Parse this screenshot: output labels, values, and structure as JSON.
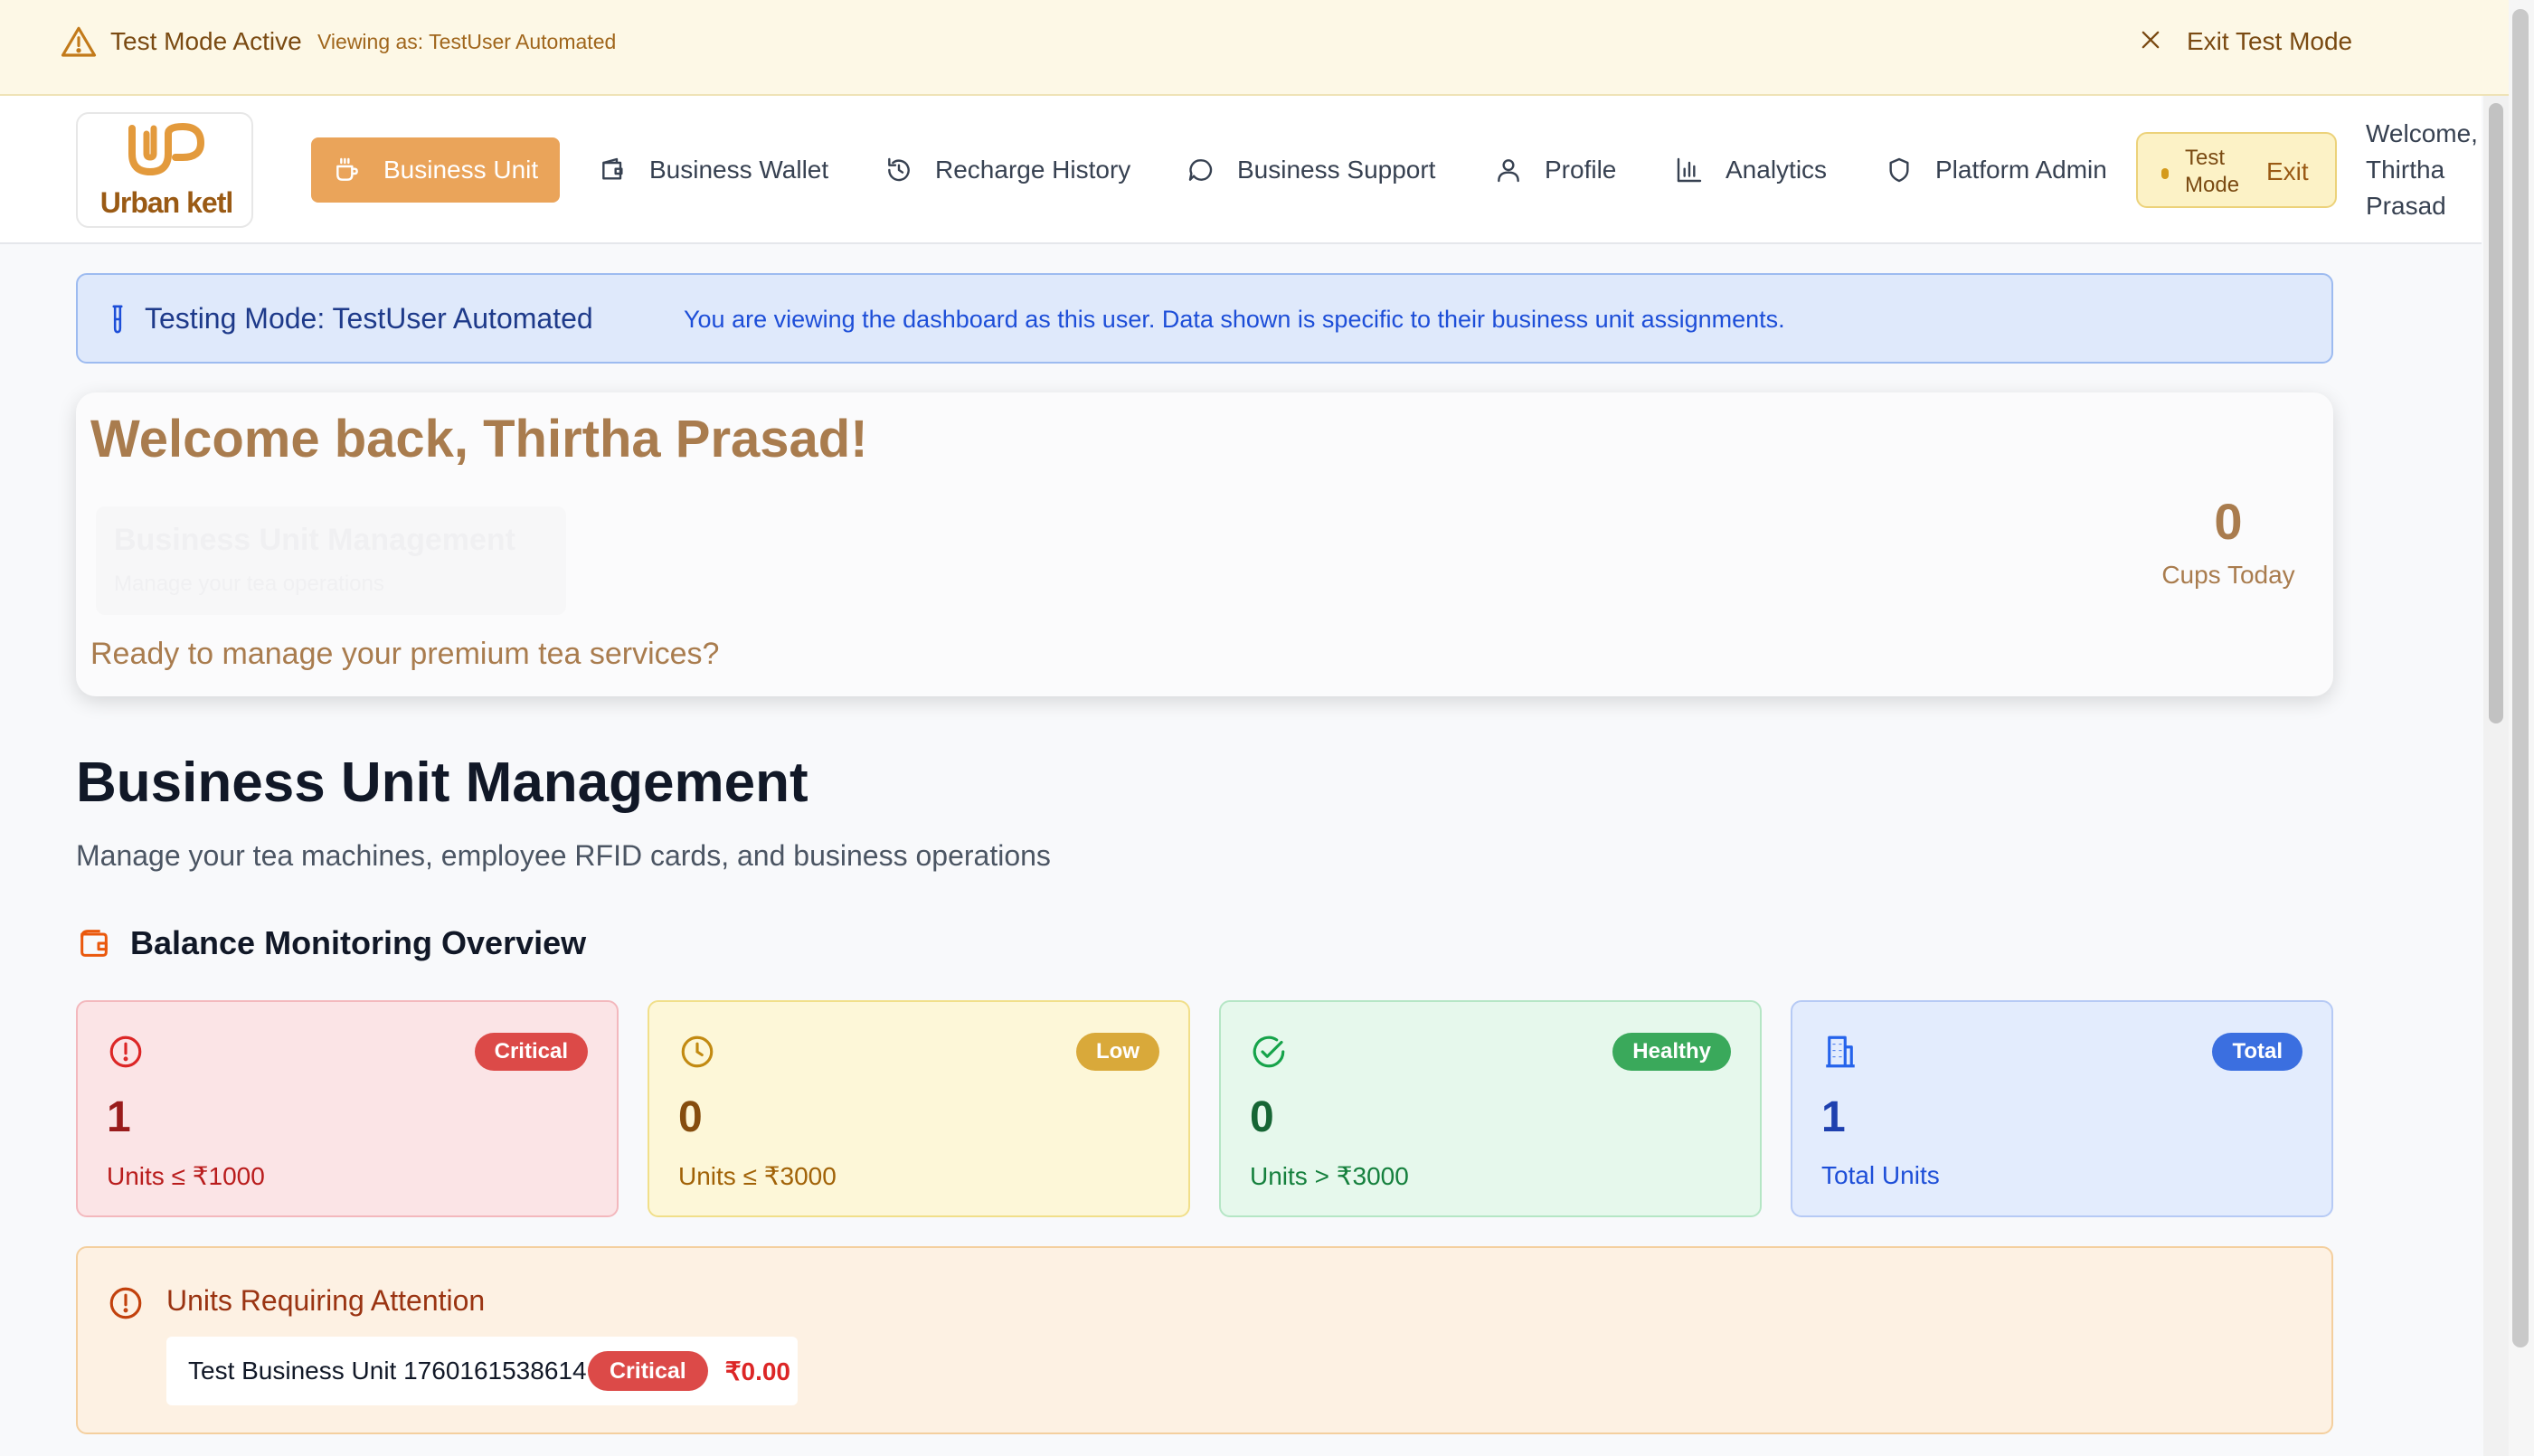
{
  "test_banner": {
    "title": "Test Mode Active",
    "viewing_as": "Viewing as: TestUser Automated",
    "exit_label": "Exit Test Mode"
  },
  "navbar": {
    "logo_text": "Urban ketl",
    "items": [
      {
        "label": "Business Unit",
        "icon": "coffee-cup-icon",
        "active": true
      },
      {
        "label": "Business Wallet",
        "icon": "wallet-icon"
      },
      {
        "label": "Recharge History",
        "icon": "history-icon"
      },
      {
        "label": "Business Support",
        "icon": "chat-bubble-icon"
      },
      {
        "label": "Profile",
        "icon": "user-icon"
      },
      {
        "label": "Analytics",
        "icon": "bar-chart-icon"
      },
      {
        "label": "Platform Admin",
        "icon": "shield-icon"
      }
    ],
    "test_pill": {
      "label": "Test Mode",
      "exit": "Exit"
    },
    "welcome": "Welcome, Thirtha Prasad"
  },
  "testing_alert": {
    "title": "Testing Mode: TestUser Automated",
    "description": "You are viewing the dashboard as this user. Data shown is specific to their business unit assignments."
  },
  "welcome_card": {
    "title": "Welcome back, Thirtha Prasad!",
    "ghost_title": "Business Unit Management",
    "ghost_sub": "Manage your tea operations",
    "subtitle": "Ready to manage your premium tea services?",
    "cups_value": "0",
    "cups_label": "Cups Today"
  },
  "page": {
    "title": "Business Unit Management",
    "subtitle": "Manage your tea machines, employee RFID cards, and business operations"
  },
  "balance": {
    "section_title": "Balance Monitoring Overview",
    "cards": [
      {
        "badge": "Critical",
        "value": "1",
        "label": "Units ≤ ₹1000",
        "color": "#dc4a48",
        "icon": "alert-circle-icon"
      },
      {
        "badge": "Low",
        "value": "0",
        "label": "Units ≤ ₹3000",
        "color": "#d9a93a",
        "icon": "clock-icon"
      },
      {
        "badge": "Healthy",
        "value": "0",
        "label": "Units > ₹3000",
        "color": "#3aa95b",
        "icon": "check-circle-icon"
      },
      {
        "badge": "Total",
        "value": "1",
        "label": "Total Units",
        "color": "#3b6fe0",
        "icon": "building-icon"
      }
    ]
  },
  "attention": {
    "title": "Units Requiring Attention",
    "units": [
      {
        "name": "Test Business Unit 1760161538614",
        "badge": "Critical",
        "amount": "₹0.00"
      }
    ]
  }
}
